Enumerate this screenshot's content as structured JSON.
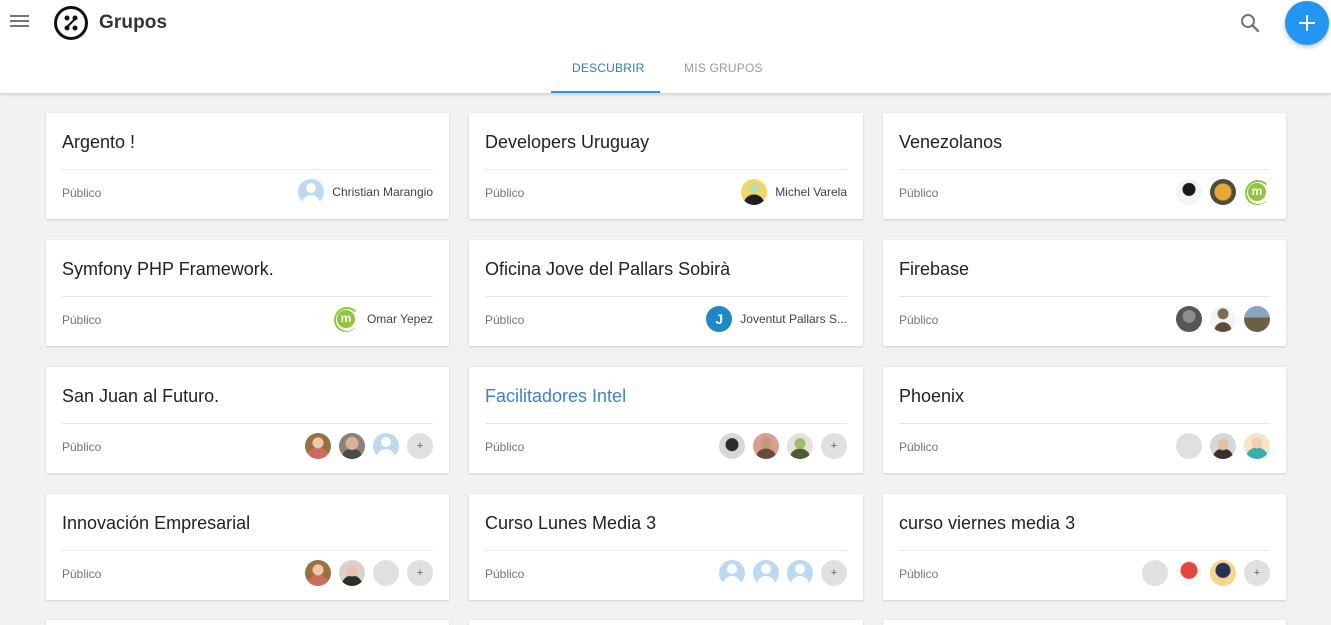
{
  "app": {
    "title": "Grupos",
    "logo_icon": "logo-icon"
  },
  "toolbar": {
    "menu_icon": "menu-icon",
    "search_icon": "search-icon",
    "add_icon": "plus-icon"
  },
  "tabs": [
    {
      "label": "DESCUBRIR",
      "active": true
    },
    {
      "label": "MIS GRUPOS",
      "active": false
    }
  ],
  "colors": {
    "accent": "#2196f3",
    "link": "#3a82d6",
    "background": "#f2f2f2"
  },
  "groups": [
    {
      "title": "Argento !",
      "visibility": "Público",
      "member_name": "Christian Marangio"
    },
    {
      "title": "Developers Uruguay",
      "visibility": "Público",
      "member_name": "Michel Varela"
    },
    {
      "title": "Venezolanos",
      "visibility": "Público"
    },
    {
      "title": "Symfony PHP Framework.",
      "visibility": "Público",
      "member_name": "Omar Yepez"
    },
    {
      "title": "Oficina Jove del Pallars Sobirà",
      "visibility": "Público",
      "member_name": "Joventut Pallars S..."
    },
    {
      "title": "Firebase",
      "visibility": "Público"
    },
    {
      "title": "San Juan al Futuro.",
      "visibility": "Público",
      "more_label": "+"
    },
    {
      "title": "Facilitadores Intel",
      "visibility": "Público",
      "more_label": "+"
    },
    {
      "title": "Phoenix",
      "visibility": "Público"
    },
    {
      "title": "Innovación Empresarial",
      "visibility": "Público",
      "more_label": "+"
    },
    {
      "title": "Curso Lunes Media 3",
      "visibility": "Público",
      "more_label": "+"
    },
    {
      "title": "curso viernes media 3",
      "visibility": "Público",
      "more_label": "+"
    }
  ]
}
